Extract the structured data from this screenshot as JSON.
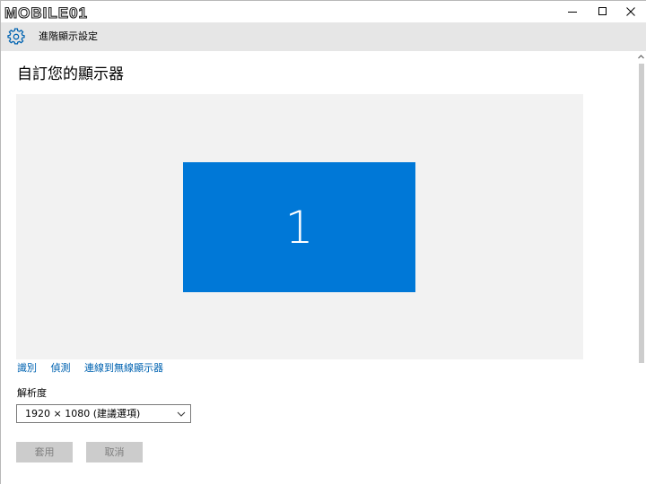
{
  "watermark": "MOBILE01",
  "header": {
    "title": "進階顯示設定"
  },
  "main": {
    "title": "自訂您的顯示器",
    "monitor_number": "1",
    "links": {
      "identify": "識別",
      "detect": "偵測",
      "connect_wireless": "連線到無線顯示器"
    },
    "resolution": {
      "label": "解析度",
      "selected": "1920 × 1080 (建議選項)"
    },
    "buttons": {
      "apply": "套用",
      "cancel": "取消"
    }
  },
  "colors": {
    "accent": "#0078d7",
    "link": "#0063b1",
    "header_bg": "#e6e6e6",
    "display_area_bg": "#f2f2f2",
    "disabled_button_bg": "#cccccc"
  }
}
